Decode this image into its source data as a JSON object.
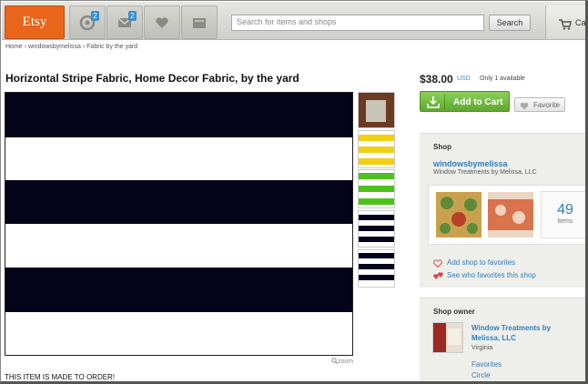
{
  "header": {
    "logo_text": "Etsy",
    "nav": [
      {
        "icon": "activity-icon",
        "badge": "2"
      },
      {
        "icon": "mail-icon",
        "badge": "2"
      },
      {
        "icon": "heart-icon",
        "badge": ""
      },
      {
        "icon": "shop-icon",
        "badge": ""
      }
    ],
    "search_placeholder": "Search for items and shops",
    "search_button": "Search",
    "cart_label": "Ca"
  },
  "breadcrumb": [
    "Home",
    "windowsbymelissa",
    "Fabric by the yard"
  ],
  "listing": {
    "title": "Horizontal Stripe Fabric, Home Decor Fabric, by the yard",
    "zoom_label": "zoom",
    "note": "THIS ITEM IS MADE TO ORDER!",
    "thumbnails": [
      {
        "name": "thumb-room-photo",
        "colors": [
          "#6b3b22",
          "#c9c4b8"
        ]
      },
      {
        "name": "thumb-yellow-stripe",
        "colors": [
          "#f2cf12"
        ]
      },
      {
        "name": "thumb-green-stripe",
        "colors": [
          "#4ec21c"
        ]
      },
      {
        "name": "thumb-black-stripe-1",
        "colors": [
          "#04041a"
        ]
      },
      {
        "name": "thumb-black-stripe-2",
        "colors": [
          "#04041a"
        ]
      }
    ]
  },
  "purchase": {
    "price": "$38.00",
    "currency": "USD",
    "availability": "Only 1 available",
    "add_to_cart": "Add to Cart",
    "favorite": "Favorite"
  },
  "shop": {
    "heading": "Shop",
    "name": "windowsbymelissa",
    "subtitle": "Window Treatments by Melissa, LLC",
    "item_count": "49",
    "item_count_label": "items",
    "add_favorites": "Add shop to favorites",
    "see_favorites": "See who favorites this shop"
  },
  "owner": {
    "heading": "Shop owner",
    "name": "Window Treatments by Melissa, LLC",
    "location": "Virginia",
    "favorites_link": "Favorites",
    "circle_link": "Circle"
  },
  "colors": {
    "accent_orange": "#e8651b",
    "link_blue": "#2f7fbf",
    "cart_green": "#5ea82c",
    "stripe_black": "#04041a"
  }
}
